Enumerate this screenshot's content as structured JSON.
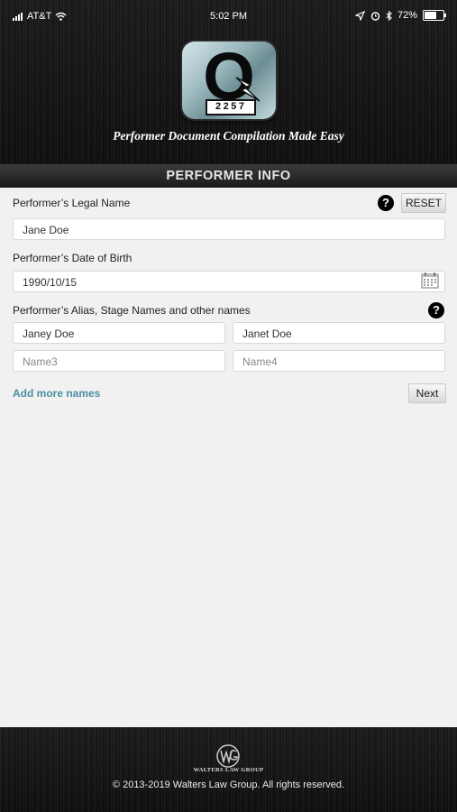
{
  "status_bar": {
    "carrier": "AT&T",
    "time": "5:02 PM",
    "battery": "72%",
    "battery_level": 0.72,
    "icons": [
      "signal-icon",
      "wifi-icon",
      "location-icon",
      "alarm-icon",
      "bluetooth-icon",
      "battery-icon"
    ]
  },
  "header": {
    "logo_letter": "Q",
    "logo_number": "2257",
    "tagline": "Performer Document Compilation Made Easy"
  },
  "section": {
    "title": "PERFORMER INFO"
  },
  "form": {
    "legal_name": {
      "label": "Performer’s Legal Name",
      "value": "Jane Doe"
    },
    "reset_label": "RESET",
    "dob": {
      "label": "Performer’s Date of Birth",
      "value": "1990/10/15"
    },
    "alias": {
      "label": "Performer’s Alias, Stage Names and other names",
      "names": [
        {
          "value": "Janey Doe",
          "placeholder": ""
        },
        {
          "value": "Janet Doe",
          "placeholder": ""
        },
        {
          "value": "",
          "placeholder": "Name3"
        },
        {
          "value": "",
          "placeholder": "Name4"
        }
      ]
    },
    "add_more_label": "Add more names",
    "next_label": "Next",
    "help_glyph": "?"
  },
  "footer": {
    "logo_text": "WALTERS LAW GROUP",
    "copyright": "© 2013-2019 Walters Law Group. All rights reserved."
  },
  "colors": {
    "link": "#4a8fa0",
    "background": "#f1f1f1",
    "header": "#141414"
  }
}
